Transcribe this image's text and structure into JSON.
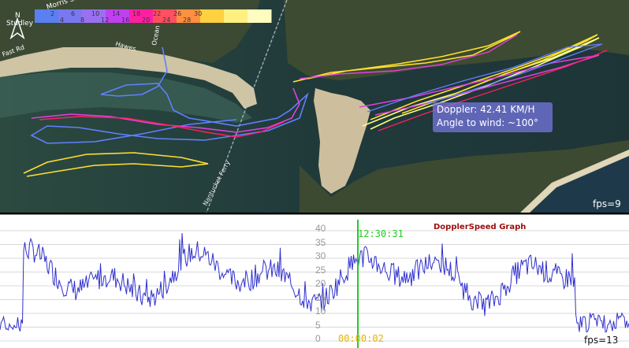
{
  "map": {
    "speed_scale": {
      "top_labels": [
        "2",
        "6",
        "10",
        "14",
        "18",
        "22",
        "26",
        "30"
      ],
      "bottom_labels": [
        "4",
        "8",
        "12",
        "16",
        "20",
        "24",
        "28"
      ],
      "colors": [
        "#5a7ff0",
        "#7a78f0",
        "#9a70f0",
        "#c040f0",
        "#ff20a0",
        "#ff5060",
        "#ff9040",
        "#ffd040",
        "#fff080",
        "#fffcc0"
      ]
    },
    "place_labels": {
      "road_a": "Morris St",
      "road_b": "Studley",
      "road_c": "Fast Rd",
      "road_d": "Ocean",
      "road_e": "Hawes",
      "ferry": "Nantucket Ferry"
    },
    "track_colors": [
      "#6080ff",
      "#e040e0",
      "#ff2060",
      "#ffe030",
      "#ffff80"
    ],
    "tooltip": {
      "line1": "Doppler: 42.41 KM/H",
      "line2": "Angle to wind: ~100°"
    },
    "fps": "fps=9"
  },
  "graph": {
    "title": "DopplerSpeed Graph",
    "cursor_time": "12:30:31",
    "elapsed": "00:00:02",
    "fps": "fps=13",
    "y_ticks": [
      "40",
      "35",
      "30",
      "25",
      "20",
      "15",
      "10",
      "5",
      "0"
    ],
    "line_color": "#3030d0",
    "cursor_color": "#22cc22"
  }
}
